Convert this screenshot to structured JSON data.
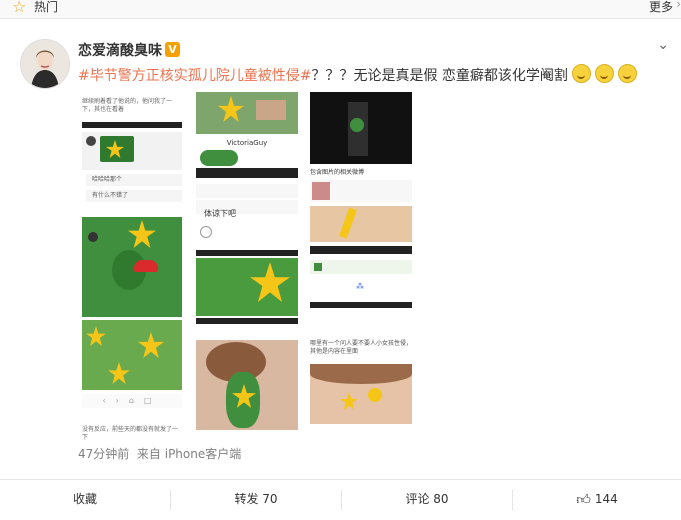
{
  "top_bar": {
    "hot_label": "热门",
    "more_label": "更多"
  },
  "post": {
    "username": "恋爱滴酸臭味",
    "verified_badge": "V",
    "hashtag": "#毕节警方正核实孤儿院儿童被性侵#",
    "body": "？？？无论是真是假 恋童癖都该化学阉割",
    "emoji_names": [
      "smile-emoji",
      "smile-emoji",
      "smile-emoji"
    ],
    "thumb_texts": {
      "col1_top": "继续刷着看了他说的，他问我了一下，其也在看着",
      "col1_bubble1": "哈哈哈那个",
      "col1_bubble2": "有什么不错了",
      "col2_title": "VictoriaGuy",
      "col2_bubble": "体谅下吧",
      "col3_heading": "包含图片的相关微博",
      "col3_caption": "哪里有一个问人要不要人小女孩性侵，其他是内容在里面",
      "col1_bottom": "没有反应，前些天的都没有就发了一下"
    },
    "time": "47分钟前",
    "source": "来自 iPhone客户端"
  },
  "actions": {
    "favorite": "收藏",
    "repost": "转发 70",
    "comment": "评论 80",
    "like": "144"
  },
  "colors": {
    "tag": "#eb7350",
    "text": "#333333",
    "meta": "#808080"
  }
}
